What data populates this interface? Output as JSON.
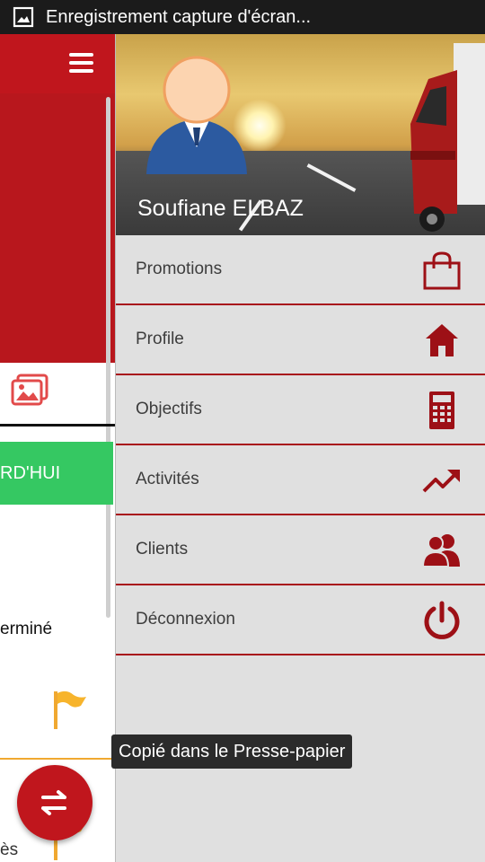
{
  "status_bar": {
    "text": "Enregistrement capture d'écran...",
    "icon": "image-icon"
  },
  "background_app": {
    "menu_icon": "hamburger-icon",
    "green_button_label": "RD'HUI",
    "status_text": "erminé",
    "bottom_text": "ès",
    "fab_icon": "swap-arrows-icon",
    "colors": {
      "primary": "#c0161d",
      "green": "#35c862",
      "orange": "#f0a830"
    }
  },
  "drawer": {
    "user_name": "Soufiane ELBAZ",
    "items": [
      {
        "label": "Promotions",
        "icon": "shopping-bag-icon"
      },
      {
        "label": "Profile",
        "icon": "home-icon"
      },
      {
        "label": "Objectifs",
        "icon": "calculator-icon"
      },
      {
        "label": "Activités",
        "icon": "trending-up-icon"
      },
      {
        "label": "Clients",
        "icon": "users-icon"
      },
      {
        "label": "Déconnexion",
        "icon": "power-icon"
      }
    ],
    "colors": {
      "accent": "#9d1016",
      "background": "#e0e0e0"
    }
  },
  "toast": {
    "text": "Copié dans le Presse-papier"
  }
}
